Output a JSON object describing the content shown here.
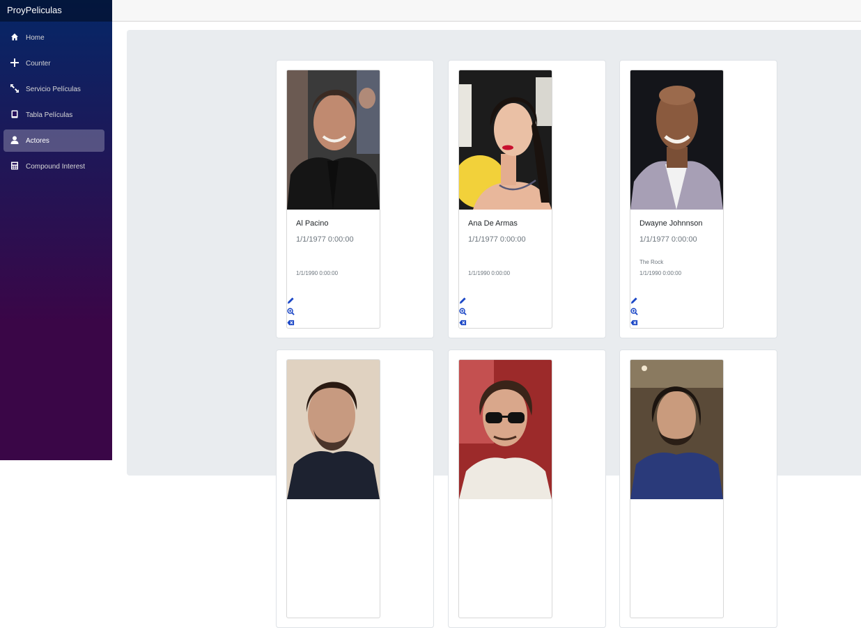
{
  "app": {
    "title": "ProyPeliculas"
  },
  "nav": [
    {
      "label": "Home",
      "icon": "home-icon",
      "active": false
    },
    {
      "label": "Counter",
      "icon": "plus-icon",
      "active": false
    },
    {
      "label": "Servicio Películas",
      "icon": "resize-icon",
      "active": false
    },
    {
      "label": "Tabla Películas",
      "icon": "tablet-icon",
      "active": false
    },
    {
      "label": "Actores",
      "icon": "person-icon",
      "active": true
    },
    {
      "label": "Compound Interest",
      "icon": "calculator-icon",
      "active": false
    }
  ],
  "actors": [
    {
      "name": "Al Pacino",
      "birth": "1/1/1977 0:00:00",
      "alias": "",
      "death": "1/1/1990 0:00:00"
    },
    {
      "name": "Ana De Armas",
      "birth": "1/1/1977 0:00:00",
      "alias": "",
      "death": "1/1/1990 0:00:00"
    },
    {
      "name": "Dwayne Johnnson",
      "birth": "1/1/1977 0:00:00",
      "alias": "The Rock",
      "death": "1/1/1990 0:00:00"
    },
    {
      "name": "",
      "birth": "",
      "alias": "",
      "death": ""
    },
    {
      "name": "",
      "birth": "",
      "alias": "",
      "death": ""
    },
    {
      "name": "",
      "birth": "",
      "alias": "",
      "death": ""
    }
  ],
  "actions": {
    "edit_icon": "pencil-icon",
    "details_icon": "zoom-in-icon",
    "delete_icon": "delete-icon"
  },
  "colors": {
    "sidebar_top": "#052767",
    "sidebar_bottom": "#3a0647",
    "action_blue": "#1b6ec2"
  }
}
